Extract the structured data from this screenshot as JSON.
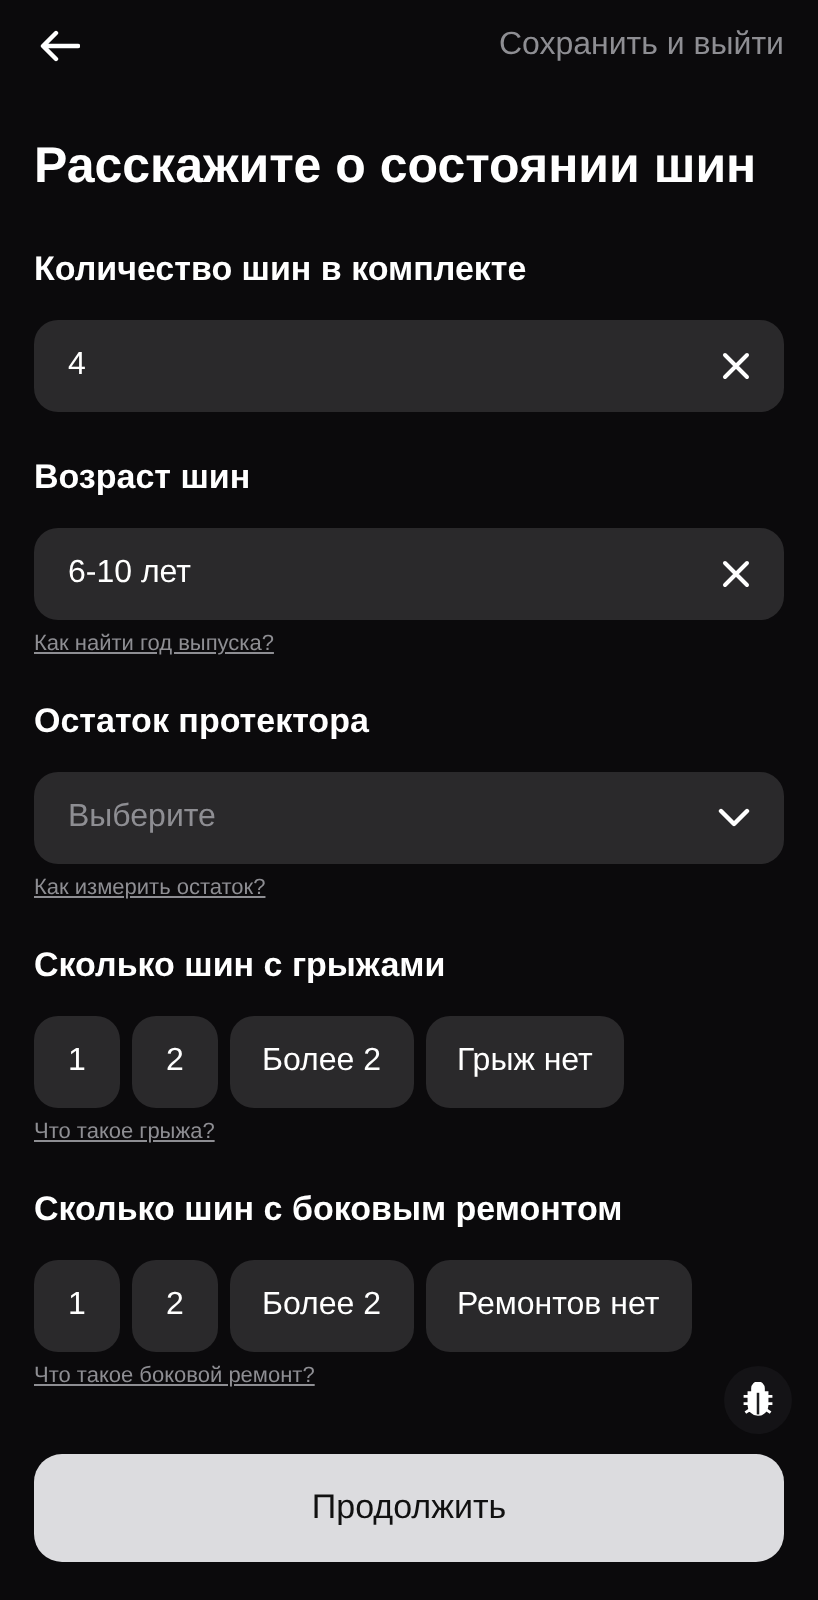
{
  "header": {
    "action": "Сохранить и выйти"
  },
  "title": "Расскажите о состоянии шин",
  "sections": [
    {
      "label": "Количество шин в комплекте",
      "kind": "text",
      "value": "4"
    },
    {
      "label": "Возраст шин",
      "kind": "text",
      "value": "6-10 лет",
      "help": "Как найти год выпуска?"
    },
    {
      "label": "Остаток протектора",
      "kind": "select",
      "placeholder": "Выберите",
      "help": "Как измерить остаток?"
    },
    {
      "label": "Сколько шин с грыжами",
      "kind": "chips",
      "options": [
        {
          "label": "1",
          "selected": false
        },
        {
          "label": "2",
          "selected": false
        },
        {
          "label": "Более 2",
          "selected": false
        },
        {
          "label": "Грыж нет",
          "selected": false
        }
      ],
      "help": "Что такое грыжа?"
    },
    {
      "label": "Сколько шин с боковым ремонтом",
      "kind": "chips",
      "options": [
        {
          "label": "1",
          "selected": false
        },
        {
          "label": "2",
          "selected": false
        },
        {
          "label": "Более 2",
          "selected": false
        },
        {
          "label": "Ремонтов нет",
          "selected": false
        }
      ],
      "help": "Что такое боковой ремонт?"
    }
  ],
  "submit": "Продолжить"
}
